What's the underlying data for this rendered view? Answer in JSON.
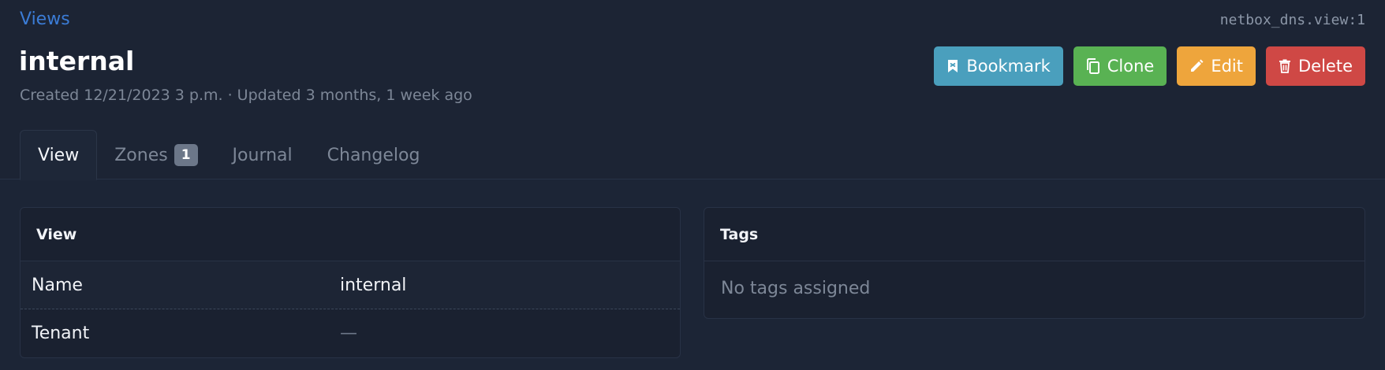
{
  "breadcrumb": {
    "label": "Views"
  },
  "object_id": "netbox_dns.view:1",
  "title": "internal",
  "meta": "Created 12/21/2023 3 p.m. · Updated 3 months, 1 week ago",
  "actions": {
    "bookmark": "Bookmark",
    "clone": "Clone",
    "edit": "Edit",
    "delete": "Delete"
  },
  "tabs": [
    {
      "label": "View",
      "active": true
    },
    {
      "label": "Zones",
      "badge": "1"
    },
    {
      "label": "Journal"
    },
    {
      "label": "Changelog"
    }
  ],
  "view_card": {
    "header": "View",
    "rows": [
      {
        "label": "Name",
        "value": "internal"
      },
      {
        "label": "Tenant",
        "value": "—"
      }
    ]
  },
  "tags_card": {
    "header": "Tags",
    "empty_text": "No tags assigned"
  },
  "colors": {
    "background": "#1c2536",
    "link": "#3b7cd6",
    "bookmark": "#4a9fbd",
    "clone": "#59b253",
    "edit": "#eea53c",
    "delete": "#cf4845"
  },
  "icons": {
    "bookmark": "bookmark-icon",
    "clone": "copy-icon",
    "edit": "pencil-icon",
    "delete": "trash-icon"
  }
}
